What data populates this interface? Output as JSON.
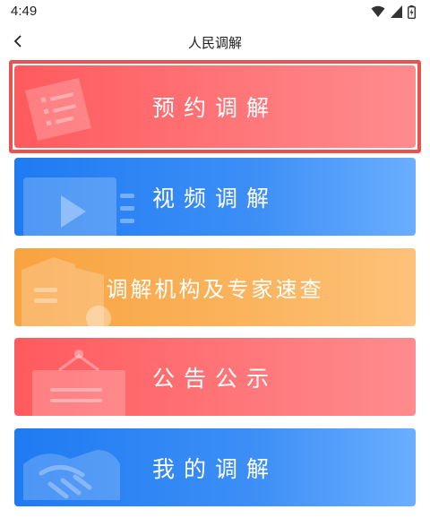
{
  "status_bar": {
    "time": "4:49",
    "icons": [
      "wifi-icon",
      "signal-icon",
      "battery-icon"
    ]
  },
  "header": {
    "back_icon": "chevron-left-icon",
    "title": "人民调解"
  },
  "menu": [
    {
      "label": "预约调解",
      "color": "red",
      "icon": "document-icon",
      "selected": true
    },
    {
      "label": "视频调解",
      "color": "blue",
      "icon": "video-play-icon",
      "selected": false
    },
    {
      "label": "调解机构及专家速查",
      "color": "orange",
      "icon": "building-icon",
      "selected": false
    },
    {
      "label": "公告公示",
      "color": "red",
      "icon": "notice-board-icon",
      "selected": false
    },
    {
      "label": "我的调解",
      "color": "blue",
      "icon": "handshake-icon",
      "selected": false
    }
  ],
  "colors": {
    "red": "#ff5a5e",
    "blue": "#1f7bf2",
    "orange": "#f8a340",
    "selection": "#e8534f"
  }
}
